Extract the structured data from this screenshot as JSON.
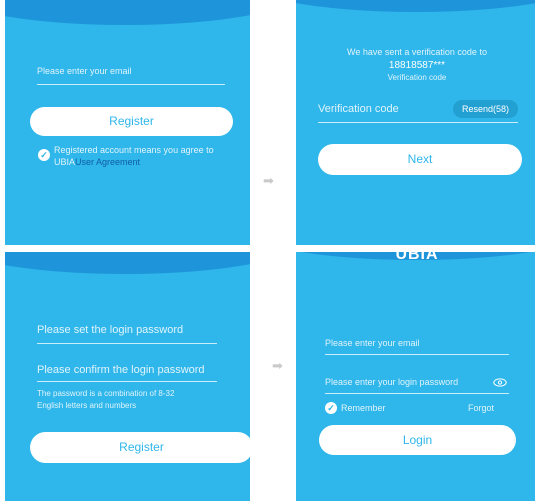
{
  "panel1": {
    "email_placeholder": "Please enter your email",
    "register_label": "Register",
    "agreement_text": "Registered account means you agree to",
    "brand": "UBIA",
    "agreement_link": "User Agreement"
  },
  "panel2": {
    "sent_text": "We have sent a verification code to",
    "phone": "18818587***",
    "caption": "Verification code",
    "code_placeholder": "Verification code",
    "resend_label": "Resend(58)",
    "next_label": "Next"
  },
  "panel3": {
    "password_placeholder": "Please set the login password",
    "confirm_placeholder": "Please confirm the login password",
    "note_line1": "The password is a combination of 8-32",
    "note_line2": "English letters and numbers",
    "register_label": "Register"
  },
  "panel4": {
    "brand": "UBIA",
    "email_placeholder": "Please enter your email",
    "password_placeholder": "Please enter your login password",
    "remember_label": "Remember",
    "forgot_label": "Forgot",
    "login_label": "Login"
  },
  "arrows": {
    "glyph": "➡"
  },
  "colors": {
    "panel_bg": "#2fb6ea",
    "arc": "#1e95da",
    "button_bg": "#ffffff",
    "button_text": "#2fb6ea",
    "link": "#0f5ea8"
  }
}
